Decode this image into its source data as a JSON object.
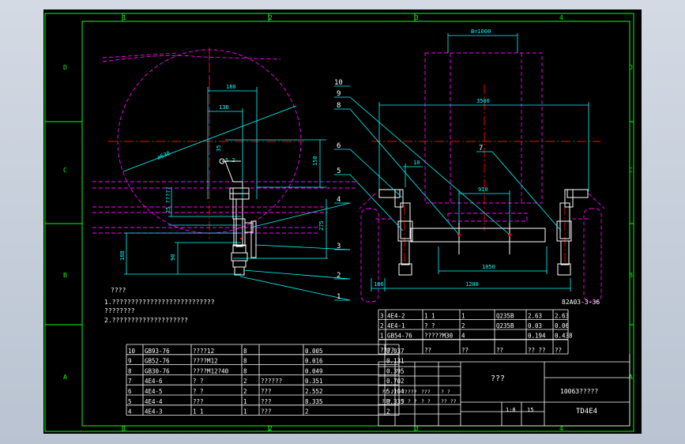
{
  "border": {
    "top_zones": [
      "1",
      "2",
      "3",
      "4"
    ],
    "bottom_zones": [
      "1",
      "2",
      "3",
      "4"
    ],
    "left_zones": [
      "D",
      "C",
      "B",
      "A"
    ],
    "right_zones": [
      "D",
      "C",
      "B",
      "A"
    ]
  },
  "dims": {
    "d_b1000": "B=1000",
    "d_3500": "3500",
    "d_180": "180",
    "d_138": "138",
    "d_630": "ø630",
    "d_150": "150",
    "d_275": "275",
    "d_188": "188",
    "d_90": "90",
    "d_10": "10",
    "d_910": "910",
    "d_1050": "1050",
    "d_1288": "1288",
    "d_106": "106",
    "d_35": "35",
    "vertical_note": "25 ?????",
    "angle_note": "5 2"
  },
  "balloons": [
    "10",
    "9",
    "8",
    "6",
    "5",
    "4",
    "3",
    "2",
    "1",
    "7"
  ],
  "notes": {
    "heading": "????",
    "line1": "1.???????????????????????????",
    "line2": "  ????????",
    "line3": "2.????????????????????"
  },
  "upper_table": {
    "label": "82A03-3-36",
    "rows": [
      [
        "3",
        "4E4-2",
        "1  1",
        "1",
        "Q235B",
        "2.63",
        "2.63"
      ],
      [
        "2",
        "4E4-1",
        "?  ?",
        "2",
        "Q235B",
        "0.03",
        "0.06"
      ],
      [
        "1",
        "GB54-76",
        "?????M30",
        "4",
        "",
        "0.194",
        "0.438"
      ]
    ],
    "header": [
      "??",
      "??",
      "??",
      "??",
      "??",
      "?? ??",
      "??"
    ]
  },
  "lower_table": {
    "rows": [
      [
        "10",
        "GB93-76",
        "????12",
        "8",
        "",
        "0.005",
        "0.037"
      ],
      [
        "9",
        "GB52-76",
        "????M12",
        "8",
        "",
        "0.016",
        "0.131"
      ],
      [
        "8",
        "GB30-76",
        "????M12?40",
        "8",
        "",
        "0.049",
        "0.395"
      ],
      [
        "7",
        "4E4-6",
        "?  ?",
        "2",
        "??????",
        "0.351",
        "0.702"
      ],
      [
        "6",
        "4E4-5",
        "?  ?",
        "2",
        "???",
        "2.552",
        "5.104"
      ],
      [
        "5",
        "4E4-4",
        "???",
        "1",
        "???",
        "8.335",
        "8.335"
      ],
      [
        "4",
        "4E4-3",
        "1  1",
        "1",
        "???",
        "2",
        "2"
      ]
    ]
  },
  "title_block": {
    "name": "???",
    "doc_no": "10063?????",
    "drawing_no": "TD4E4",
    "scale": "1:8",
    "sheet": "15",
    "cells": [
      "?? ??",
      "?????",
      "???",
      "? ?",
      "???",
      "? ? ?",
      "? ?",
      "?? ??"
    ]
  },
  "colors": {
    "border": "#00ff00",
    "outline": "#ffffff",
    "dim": "#00ffff",
    "hidden": "#ff00ff",
    "center": "#ff0000",
    "text": "#ffffff"
  }
}
